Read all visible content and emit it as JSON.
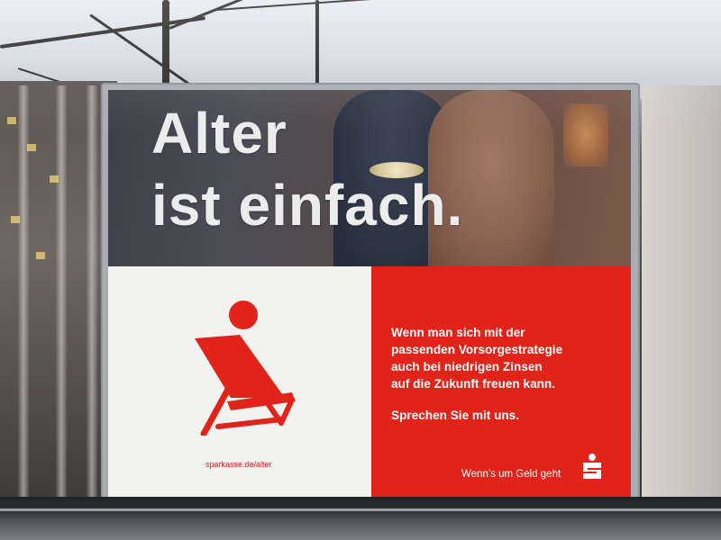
{
  "poster": {
    "headline_line1": "Alter",
    "headline_line2": "ist einfach.",
    "body_line1": "Wenn man sich mit der",
    "body_line2": "passenden Vorsorgestrategie",
    "body_line3": "auch bei niedrigen Zinsen",
    "body_line4": "auf die Zukunft freuen kann.",
    "call_to_action": "Sprechen Sie mit uns.",
    "website": "sparkasse.de/alter",
    "slogan": "Wenn’s um Geld geht",
    "logo_icon": "sparkasse-s-logo",
    "illustration_icon": "deck-chair-sun-icon"
  },
  "colors": {
    "brand_red": "#e2231a",
    "panel_white": "#f2f2f0",
    "headline_text": "#ececec"
  }
}
